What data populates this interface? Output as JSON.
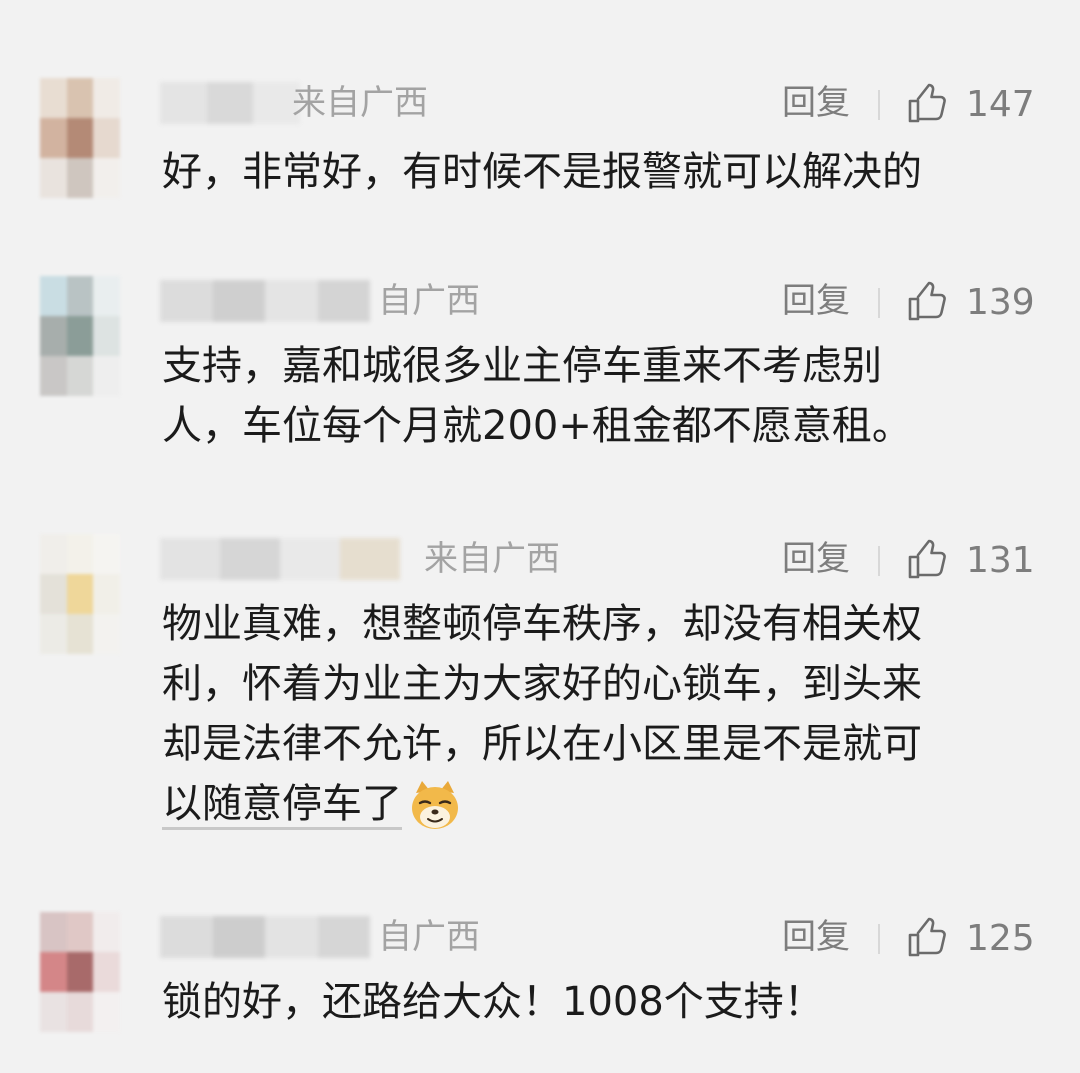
{
  "reply_label": "回复",
  "comments": [
    {
      "location": "来自广西",
      "likes": "147",
      "lines": [
        "好，非常好，有时候不是报警就可以解决的"
      ]
    },
    {
      "location": "自广西",
      "likes": "139",
      "lines": [
        "支持，嘉和城很多业主停车重来不考虑别",
        "人，车位每个月就200+租金都不愿意租。"
      ]
    },
    {
      "location": "来自广西",
      "likes": "131",
      "lines": [
        "物业真难，想整顿停车秩序，却没有相关权",
        "利，怀着为业主为大家好的心锁车，到头来",
        "却是法律不允许，所以在小区里是不是就可",
        "以随意停车了"
      ],
      "emoji": "doge-emoji"
    },
    {
      "location": "自广西",
      "likes": "125",
      "lines": [
        "锁的好，还路给大众！1008个支持！"
      ]
    }
  ]
}
